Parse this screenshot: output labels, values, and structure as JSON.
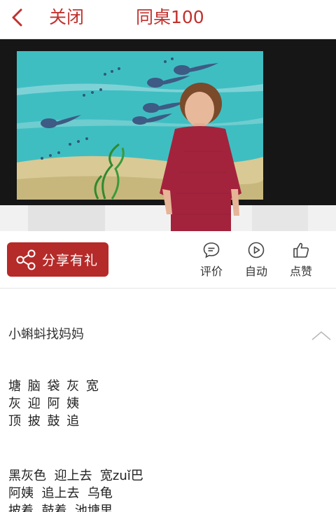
{
  "header": {
    "back_icon": "chevron-left-icon",
    "close_label": "关闭",
    "title": "同桌100"
  },
  "actions": {
    "share_label": "分享有礼",
    "share_icon": "share-icon",
    "comment_label": "评价",
    "auto_label": "自动",
    "like_label": "点赞"
  },
  "content": {
    "lesson_title": "小蝌蚪找妈妈",
    "char_rows": [
      "塘 脑 袋 灰 宽",
      "灰 迎 阿 姨",
      "顶 披 鼓 追"
    ],
    "word_rows": [
      "黑灰色  迎上去  宽zuǐ巴",
      "阿姨  追上去  乌龟",
      "披着  鼓着  池塘里"
    ]
  },
  "colors": {
    "accent": "#c0322e",
    "share_button": "#b52b29",
    "pond_water": "#3fbec2",
    "teacher_dress": "#a3233d"
  }
}
